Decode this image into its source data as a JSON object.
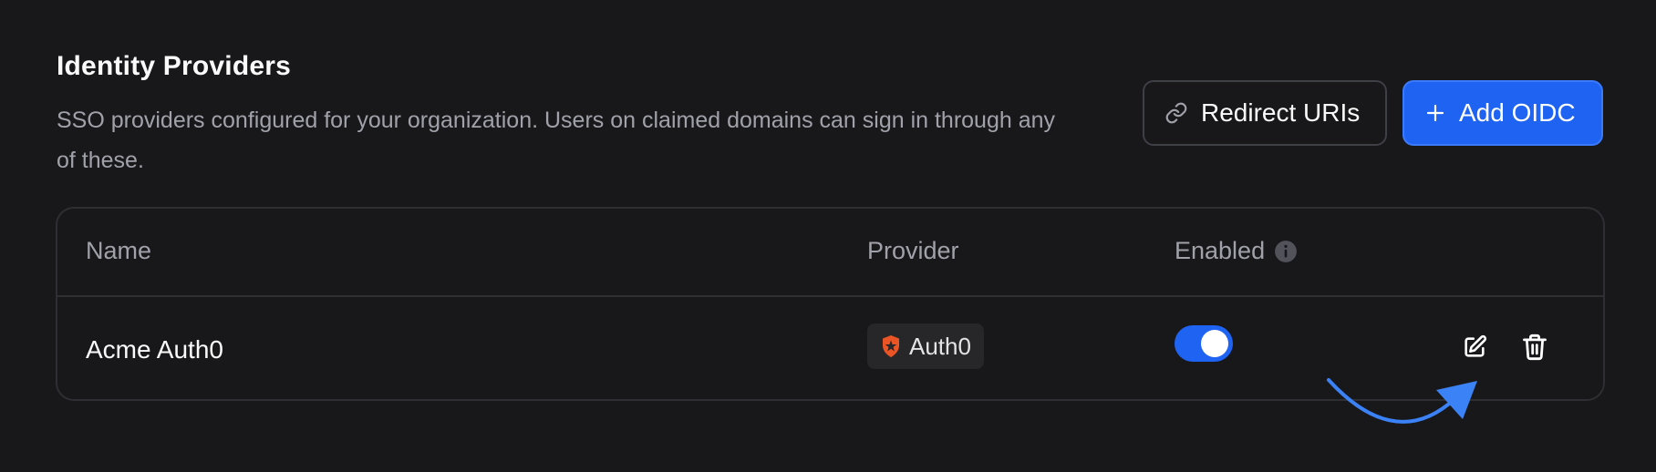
{
  "section": {
    "title": "Identity Providers",
    "description": "SSO providers configured for your organization. Users on claimed domains can sign in through any of these."
  },
  "actions": {
    "redirect_label": "Redirect URIs",
    "add_label": "Add OIDC"
  },
  "table": {
    "columns": {
      "name": "Name",
      "provider": "Provider",
      "enabled": "Enabled"
    },
    "rows": [
      {
        "name": "Acme Auth0",
        "provider": "Auth0",
        "enabled": true
      }
    ]
  },
  "colors": {
    "background": "#18181b",
    "accent": "#1f63f2",
    "auth0_brand": "#eb5424",
    "muted_text": "#a1a1aa"
  },
  "icons": {
    "redirect": "link-icon",
    "add": "plus-icon",
    "info": "info-icon",
    "provider": "auth0-logo-icon",
    "edit": "edit-icon",
    "delete": "trash-icon",
    "annotation": "curved-arrow-icon"
  }
}
